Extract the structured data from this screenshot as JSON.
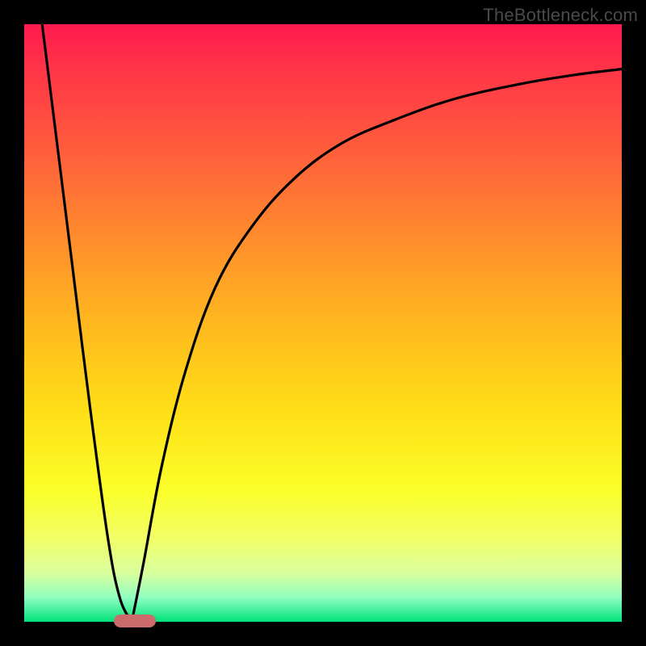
{
  "watermark": "TheBottleneck.com",
  "colors": {
    "frame": "#000000",
    "watermark": "#4a4a4a",
    "curve": "#000000",
    "marker": "#cc6b6b",
    "gradient_top": "#ff1a4d",
    "gradient_bottom": "#00e27a"
  },
  "chart_data": {
    "type": "line",
    "title": "",
    "xlabel": "",
    "ylabel": "",
    "xlim": [
      0,
      100
    ],
    "ylim": [
      0,
      100
    ],
    "grid": false,
    "legend": false,
    "annotations": [
      {
        "text": "TheBottleneck.com",
        "position": "top-right"
      }
    ],
    "series": [
      {
        "name": "left-branch",
        "x": [
          3,
          5,
          8,
          11,
          14,
          16,
          18
        ],
        "values": [
          100,
          84,
          60,
          36,
          14,
          4,
          0
        ]
      },
      {
        "name": "right-branch",
        "x": [
          18,
          20,
          23,
          27,
          32,
          38,
          45,
          53,
          62,
          72,
          83,
          92,
          100
        ],
        "values": [
          0,
          10,
          26,
          42,
          56,
          66,
          74,
          80,
          84,
          87.5,
          90,
          91.5,
          92.5
        ]
      }
    ],
    "marker": {
      "x_start": 15,
      "x_end": 22,
      "y": 0
    }
  }
}
